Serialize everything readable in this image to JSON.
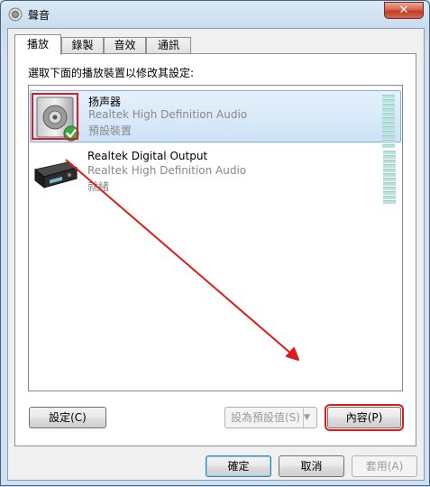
{
  "window": {
    "title": "聲音",
    "close_glyph": "✕"
  },
  "tabs": [
    {
      "label": "播放",
      "active": true
    },
    {
      "label": "錄製",
      "active": false
    },
    {
      "label": "音效",
      "active": false
    },
    {
      "label": "通訊",
      "active": false
    }
  ],
  "instruction": "選取下面的播放裝置以修改其設定:",
  "devices": [
    {
      "name": "扬声器",
      "driver": "Realtek High Definition Audio",
      "status": "預設裝置",
      "icon": "speaker-icon",
      "selected": true
    },
    {
      "name": "Realtek Digital Output",
      "driver": "Realtek High Definition Audio",
      "status": "就緒",
      "icon": "digital-output-device-icon",
      "selected": false
    }
  ],
  "panel_buttons": {
    "configure": "設定(C)",
    "set_default": "設為預設值(S)",
    "properties": "內容(P)"
  },
  "dialog_buttons": {
    "ok": "確定",
    "cancel": "取消",
    "apply": "套用(A)"
  },
  "annotation_color": "#e01b1b"
}
